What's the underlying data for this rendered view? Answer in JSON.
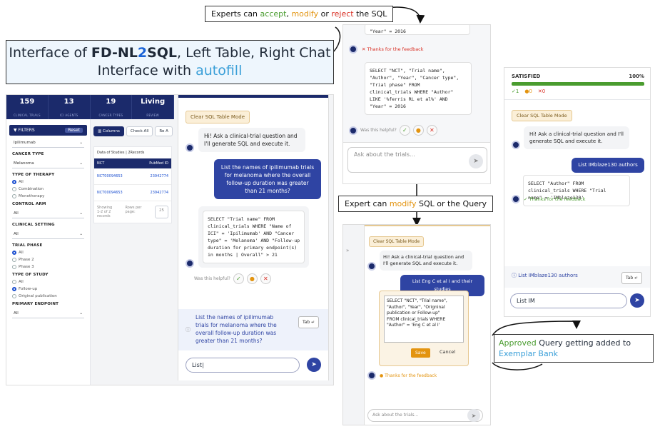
{
  "captions": {
    "top_pre": "Experts can ",
    "top_accept": "accept",
    "top_sep": ", ",
    "top_modify": "modify",
    "top_or": " or ",
    "top_reject": "reject",
    "top_post": " the SQL",
    "mid_pre": "Expert can ",
    "mid_modify": "modify",
    "mid_post": " SQL or the Query",
    "bot_approved": "Approved",
    "bot_mid": " Query getting added to",
    "bot_bank": "Exemplar Bank"
  },
  "title": {
    "pre": "Interface of ",
    "name_a": "FD-NL",
    "name_b": "2",
    "name_c": "SQL",
    "post1": ", Left Table, Right Chat",
    "line2": "Interface with ",
    "autofill": "autofill"
  },
  "left": {
    "stats": [
      {
        "n": "159",
        "l": "CLINICAL TRIALS"
      },
      {
        "n": "13",
        "l": "ICI AGENTS"
      },
      {
        "n": "19",
        "l": "CANCER TYPES"
      },
      {
        "n": "Living",
        "l": "REVIEW"
      }
    ],
    "filters": "FILTERS",
    "reset": "Reset",
    "agent": "Ipilimumab",
    "cancer_type": "CANCER TYPE",
    "cancer_val": "Melanoma",
    "therapy": "TYPE OF THERAPY",
    "therapy_opts": [
      "All",
      "Combination",
      "Monotherapy"
    ],
    "control": "CONTROL ARM",
    "control_val": "All",
    "setting": "CLINICAL SETTING",
    "setting_val": "All",
    "phase": "TRIAL PHASE",
    "phase_opts": [
      "All",
      "Phase 2",
      "Phase 3"
    ],
    "study": "TYPE OF STUDY",
    "study_opts": [
      "All",
      "Follow-up",
      "Original publication"
    ],
    "endpoint": "PRIMARY ENDPOINT",
    "endpoint_val": "All",
    "columns": "Columns",
    "check_all": "Check All",
    "re": "Re A",
    "data_label": "Data of Studies | 2Records",
    "col_nct": "NCT",
    "col_pm": "PubMed ID",
    "rows": [
      {
        "nct": "NCT00094653",
        "pm": "23942774"
      },
      {
        "nct": "NCT00094653",
        "pm": "23942774"
      }
    ],
    "showing": "Showing 1-2 of 2 records",
    "rows_per": "Rows per page:",
    "rows_n": "25",
    "clear": "Clear SQL Table Mode",
    "greet": "Hi! Ask a clinical-trial question and I'll generate SQL and execute it.",
    "user_q": "List the names of ipilimumab trials for melanoma where the overall follow-up duration was greater than 21 months?",
    "sql": "SELECT \"Trial name\" FROM\nclinical_trials WHERE \"Name of\nICI\" = 'Ipilimumab' AND \"Cancer\ntype\" = 'Melanoma' AND \"Follow-up\nduration for primary endpoint(s)\nin months | Overall\" > 21",
    "helpful": "Was this helpful?",
    "suggestion": "List the names of ipilimumab trials for melanoma where the overall follow-up duration was greater than 21 months?",
    "tab": "Tab ↵",
    "input": "List|"
  },
  "top_mid": {
    "sql_prev": "\"Year\" = 2016",
    "thanks": "Thanks for the feedback",
    "sql": "SELECT \"NCT\", \"Trial name\",\n\"Author\", \"Year\", \"Cancer type\",\n\"Trial phase\" FROM\nclinical_trials WHERE \"Author\"\nLIKE '%ferris RL et al%' AND\n\"Year\" = 2016",
    "helpful": "Was this helpful?",
    "placeholder": "Ask about the trials..."
  },
  "bot_mid": {
    "clear": "Clear SQL Table Mode",
    "greet": "Hi! Ask a clinical-trial question and I'll generate SQL and execute it.",
    "user_q": "List Eng C et al I and their studies",
    "sql": "SELECT \"NCT\", \"Trial name\",\n\"Author\", \"Year\", \"Origninal\npublication or Follow-up\"\nFROM clinical_trials WHERE\n\"Author\" = 'Eng C et al I'",
    "save": "Save",
    "cancel": "Cancel",
    "thanks": "Thanks for the feedback",
    "placeholder": "Ask about the trials..."
  },
  "right": {
    "satisfied": "SATISFIED",
    "pct": "100%",
    "counts": {
      "ok": "✓1",
      "mod": "●0",
      "rej": "✕0"
    },
    "clear": "Clear SQL Table Mode",
    "greet": "Hi! Ask a clinical-trial question and I'll generate SQL and execute it.",
    "user_q": "List IMblaze130 authors",
    "sql": "SELECT \"Author\" FROM\nclinical_trials WHERE \"Trial\nname\" = 'IMblaze130'",
    "thanks": "Thanks for the feedback",
    "suggestion": "List IMblaze130 authors",
    "tab": "Tab ↵",
    "input": "List IM"
  },
  "colors": {
    "navy": "#1b2a6b",
    "blue": "#2f44a3",
    "green": "#4a9c2f",
    "orange": "#e39410",
    "red": "#d93025",
    "light": "#3a9fd8"
  }
}
